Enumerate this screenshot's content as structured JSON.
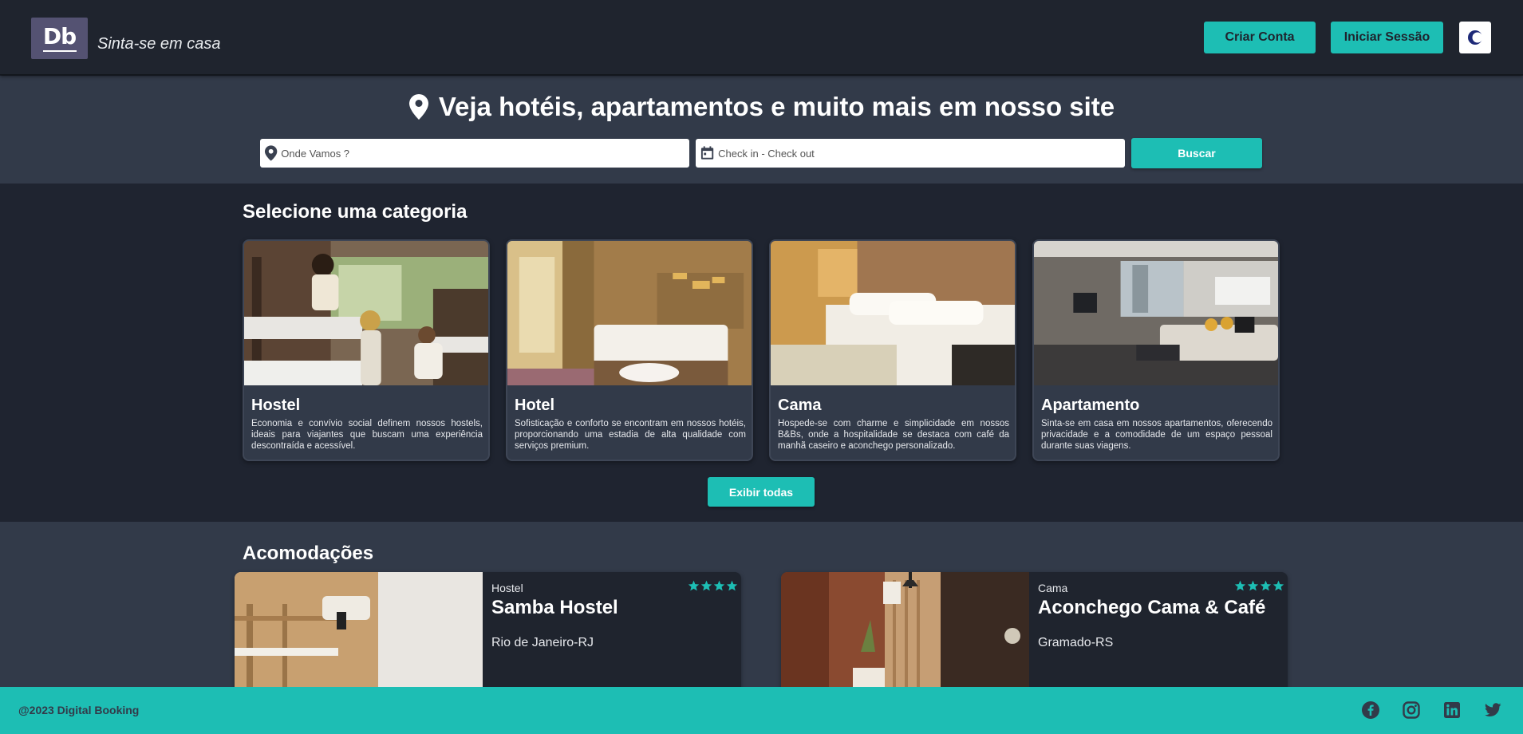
{
  "header": {
    "logo_text": "Db",
    "tagline": "Sinta-se em casa",
    "create_account_label": "Criar Conta",
    "login_label": "Iniciar Sessão"
  },
  "search": {
    "title": "Veja hotéis, apartamentos e muito mais em nosso site",
    "destination_placeholder": "Onde Vamos ?",
    "dates_placeholder": "Check in - Check out",
    "button_label": "Buscar"
  },
  "categories": {
    "title": "Selecione uma categoria",
    "items": [
      {
        "name": "Hostel",
        "description": "Economia e convívio social definem nossos hostels, ideais para viajantes que buscam uma experiência descontraída e acessível."
      },
      {
        "name": "Hotel",
        "description": "Sofisticação e conforto se encontram em nossos hotéis, proporcionando uma estadia de alta qualidade com serviços premium."
      },
      {
        "name": "Cama",
        "description": "Hospede-se com charme e simplicidade em nossos B&Bs, onde a hospitalidade se destaca com café da manhã caseiro e aconchego personalizado."
      },
      {
        "name": "Apartamento",
        "description": "Sinta-se em casa em nossos apartamentos, oferecendo privacidade e a comodidade de um espaço pessoal durante suas viagens."
      }
    ],
    "show_all_label": "Exibir todas"
  },
  "accommodations": {
    "title": "Acomodações",
    "items": [
      {
        "category": "Hostel",
        "name": "Samba Hostel",
        "location": "Rio de Janeiro-RJ",
        "stars": 4
      },
      {
        "category": "Cama",
        "name": "Aconchego Cama & Café",
        "location": "Gramado-RS",
        "stars": 4
      }
    ]
  },
  "footer": {
    "copyright": "@2023 Digital Booking",
    "socials": [
      "facebook-icon",
      "instagram-icon",
      "linkedin-icon",
      "twitter-icon"
    ]
  },
  "colors": {
    "accent": "#1dbeb4",
    "header_bg": "#1f242e",
    "section_bg": "#323a49",
    "logo_bg": "#545272"
  }
}
